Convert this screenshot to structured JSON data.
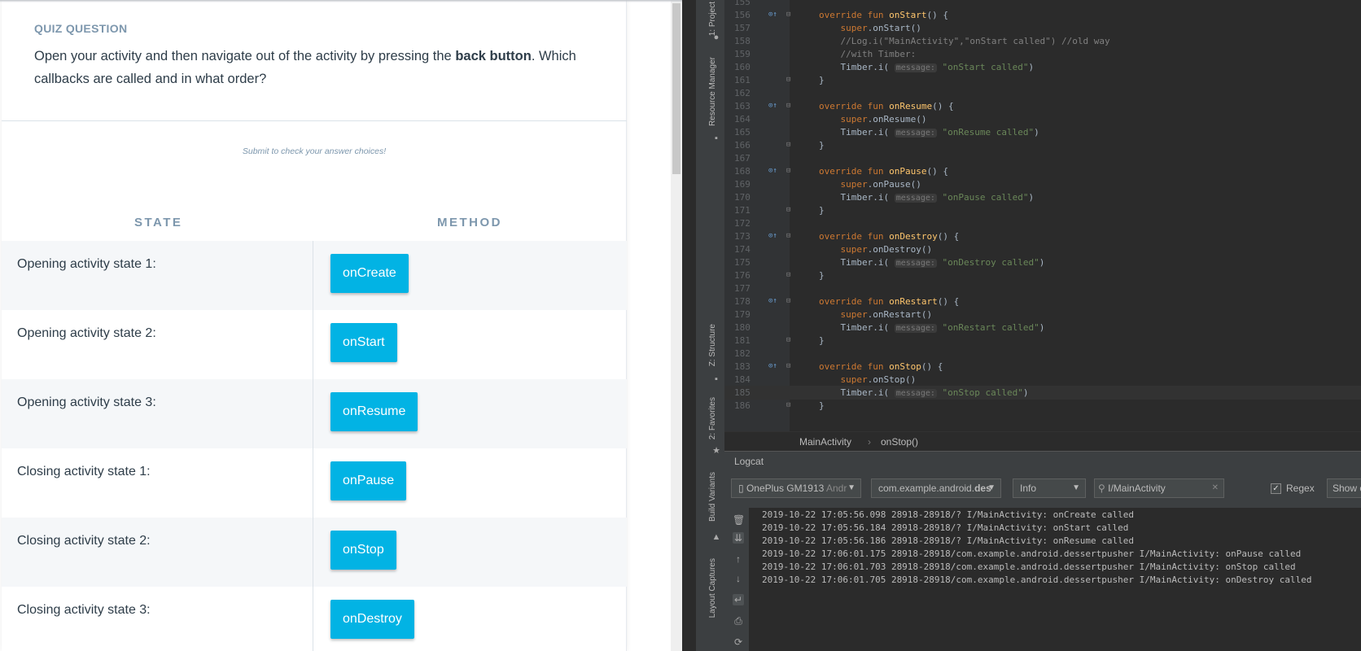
{
  "quiz": {
    "kicker": "QUIZ QUESTION",
    "question_pre": "Open your activity and then navigate out of the activity by pressing the ",
    "question_bold": "back button",
    "question_post": ". Which callbacks are called and in what order?",
    "submit_hint": "Submit to check your answer choices!",
    "col_state": "STATE",
    "col_method": "METHOD",
    "rows": [
      {
        "state": "Opening activity state 1:",
        "method": "onCreate"
      },
      {
        "state": "Opening activity state 2:",
        "method": "onStart"
      },
      {
        "state": "Opening activity state 3:",
        "method": "onResume"
      },
      {
        "state": "Closing activity state 1:",
        "method": "onPause"
      },
      {
        "state": "Closing activity state 2:",
        "method": "onStop"
      },
      {
        "state": "Closing activity state 3:",
        "method": "onDestroy"
      }
    ]
  },
  "ide": {
    "side_tabs": [
      "1: Project",
      "Resource Manager",
      "Z: Structure",
      "2: Favorites",
      "Build Variants",
      "Layout Captures"
    ],
    "code_lines": [
      {
        "n": "155",
        "text": ""
      },
      {
        "n": "156",
        "text": "override fun onStart() {"
      },
      {
        "n": "157",
        "text": "    super.onStart()"
      },
      {
        "n": "158",
        "text": "    //Log.i(\"MainActivity\",\"onStart called\") //old way"
      },
      {
        "n": "159",
        "text": "    //with Timber:"
      },
      {
        "n": "160",
        "text": "    Timber.i( message: \"onStart called\")"
      },
      {
        "n": "161",
        "text": "}"
      },
      {
        "n": "162",
        "text": ""
      },
      {
        "n": "163",
        "text": "override fun onResume() {"
      },
      {
        "n": "164",
        "text": "    super.onResume()"
      },
      {
        "n": "165",
        "text": "    Timber.i( message: \"onResume called\")"
      },
      {
        "n": "166",
        "text": "}"
      },
      {
        "n": "167",
        "text": ""
      },
      {
        "n": "168",
        "text": "override fun onPause() {"
      },
      {
        "n": "169",
        "text": "    super.onPause()"
      },
      {
        "n": "170",
        "text": "    Timber.i( message: \"onPause called\")"
      },
      {
        "n": "171",
        "text": "}"
      },
      {
        "n": "172",
        "text": ""
      },
      {
        "n": "173",
        "text": "override fun onDestroy() {"
      },
      {
        "n": "174",
        "text": "    super.onDestroy()"
      },
      {
        "n": "175",
        "text": "    Timber.i( message: \"onDestroy called\")"
      },
      {
        "n": "176",
        "text": "}"
      },
      {
        "n": "177",
        "text": ""
      },
      {
        "n": "178",
        "text": "override fun onRestart() {"
      },
      {
        "n": "179",
        "text": "    super.onRestart()"
      },
      {
        "n": "180",
        "text": "    Timber.i( message: \"onRestart called\")"
      },
      {
        "n": "181",
        "text": "}"
      },
      {
        "n": "182",
        "text": ""
      },
      {
        "n": "183",
        "text": "override fun onStop() {"
      },
      {
        "n": "184",
        "text": "    super.onStop()"
      },
      {
        "n": "185",
        "text": "    Timber.i( message: \"onStop called\")"
      },
      {
        "n": "186",
        "text": "}"
      }
    ],
    "breadcrumb": {
      "class": "MainActivity",
      "method": "onStop()"
    },
    "logcat": {
      "title": "Logcat",
      "device": "OnePlus GM1913",
      "device_suffix": "Andr",
      "package_prefix": "com.example.android.",
      "package_bold": "des",
      "level": "Info",
      "filter_value": "I/MainActivity",
      "regex_label": "Regex",
      "show_label": "Show o",
      "lines": [
        "2019-10-22 17:05:56.098 28918-28918/? I/MainActivity: onCreate called",
        "2019-10-22 17:05:56.184 28918-28918/? I/MainActivity: onStart called",
        "2019-10-22 17:05:56.186 28918-28918/? I/MainActivity: onResume called",
        "2019-10-22 17:06:01.175 28918-28918/com.example.android.dessertpusher I/MainActivity: onPause called",
        "2019-10-22 17:06:01.703 28918-28918/com.example.android.dessertpusher I/MainActivity: onStop called",
        "2019-10-22 17:06:01.705 28918-28918/com.example.android.dessertpusher I/MainActivity: onDestroy called"
      ]
    }
  },
  "colors": {
    "accent": "#02b3e4",
    "ide_bg": "#2b2b2b",
    "keyword": "#cc7832",
    "function": "#ffc66d",
    "string": "#6a8759"
  }
}
